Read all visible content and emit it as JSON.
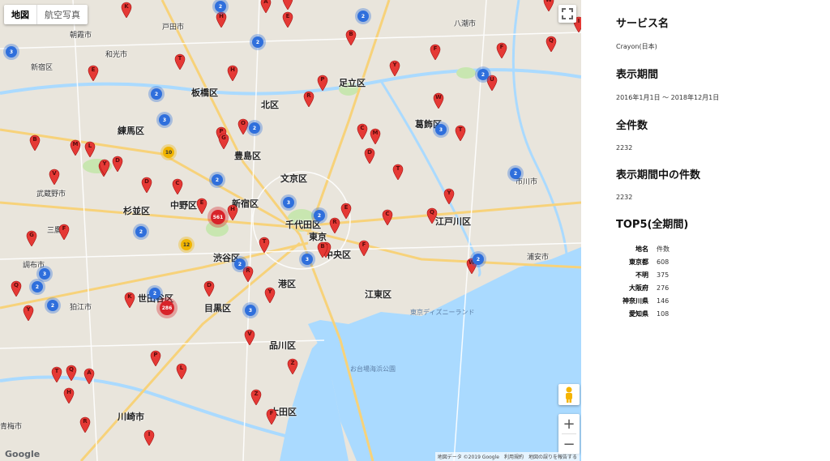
{
  "map": {
    "maptype": {
      "map_label": "地図",
      "satellite_label": "航空写真"
    },
    "logo": "Google",
    "attribution": {
      "data": "地図データ ©2019 Google",
      "terms": "利用規約",
      "report": "地図の誤りを報告する"
    },
    "zoom": {
      "in": "+",
      "out": "−"
    },
    "places": [
      "新宿区",
      "板橋区",
      "足立区",
      "北区",
      "練馬区",
      "豊島区",
      "文京区",
      "中野区",
      "杉並区",
      "新宿区",
      "千代田区",
      "東京",
      "渋谷区",
      "港区",
      "中央区",
      "江東区",
      "世田谷区",
      "品川区",
      "目黒区",
      "大田区",
      "江戸川区",
      "葛飾区",
      "川崎市",
      "狛江市",
      "三鷹市",
      "武蔵野市",
      "調布市",
      "お台場海浜公園",
      "東京ディズニーランド",
      "市川市",
      "浦安市",
      "八潮市",
      "朝霞市",
      "和光市",
      "戸田市",
      "青梅市"
    ],
    "pins": [
      "K",
      "H",
      "A",
      "N",
      "E",
      "B",
      "Y",
      "F",
      "T",
      "H",
      "W",
      "F",
      "I",
      "U",
      "Q",
      "P",
      "R",
      "E",
      "W",
      "T",
      "C",
      "M",
      "M",
      "B",
      "L",
      "K",
      "D",
      "V",
      "D",
      "C",
      "E",
      "P",
      "G",
      "O",
      "D",
      "T",
      "Y",
      "H",
      "Q",
      "C",
      "T",
      "C",
      "F",
      "R",
      "E",
      "F",
      "G",
      "Q",
      "Y",
      "R",
      "W",
      "B",
      "D",
      "Y",
      "V",
      "Z",
      "Z",
      "F",
      "I",
      "K",
      "R",
      "T",
      "Q",
      "P",
      "L",
      "H",
      "A",
      "Y",
      "O"
    ],
    "clusters": [
      {
        "label": "2",
        "color": "blue"
      },
      {
        "label": "2",
        "color": "blue"
      },
      {
        "label": "3",
        "color": "blue"
      },
      {
        "label": "2",
        "color": "blue"
      },
      {
        "label": "2",
        "color": "blue"
      },
      {
        "label": "2",
        "color": "blue"
      },
      {
        "label": "10",
        "color": "yellow"
      },
      {
        "label": "3",
        "color": "blue"
      },
      {
        "label": "2",
        "color": "blue"
      },
      {
        "label": "3",
        "color": "blue"
      },
      {
        "label": "2",
        "color": "blue"
      },
      {
        "label": "2",
        "color": "blue"
      },
      {
        "label": "3",
        "color": "blue"
      },
      {
        "label": "2",
        "color": "blue"
      },
      {
        "label": "2",
        "color": "blue"
      },
      {
        "label": "12",
        "color": "yellow"
      },
      {
        "label": "2",
        "color": "blue"
      },
      {
        "label": "3",
        "color": "blue"
      },
      {
        "label": "2",
        "color": "blue"
      },
      {
        "label": "3",
        "color": "blue"
      },
      {
        "label": "2",
        "color": "blue"
      },
      {
        "label": "2",
        "color": "blue"
      },
      {
        "label": "2",
        "color": "blue"
      },
      {
        "label": "3",
        "color": "blue"
      },
      {
        "label": "286",
        "color": "red"
      },
      {
        "label": "561",
        "color": "red"
      }
    ]
  },
  "panel": {
    "service_heading": "サービス名",
    "service_value": "Crayon(日本)",
    "period_heading": "表示期間",
    "period_value": "2016年1月1日 〜 2018年12月1日",
    "total_heading": "全件数",
    "total_value": "2232",
    "period_count_heading": "表示期間中の件数",
    "period_count_value": "2232",
    "top5_heading": "TOP5(全期間)",
    "top5_header": {
      "area": "地名",
      "count": "件数"
    },
    "top5_rows": [
      {
        "area": "東京都",
        "count": "608"
      },
      {
        "area": "不明",
        "count": "375"
      },
      {
        "area": "大阪府",
        "count": "276"
      },
      {
        "area": "神奈川県",
        "count": "146"
      },
      {
        "area": "愛知県",
        "count": "108"
      }
    ]
  },
  "colors": {
    "pin": "#e53935",
    "cluster_blue": "#2f6fdc",
    "cluster_yellow": "#f0b400",
    "cluster_red": "#d8232a",
    "water": "#aadaff",
    "park": "#c8e6b0"
  }
}
